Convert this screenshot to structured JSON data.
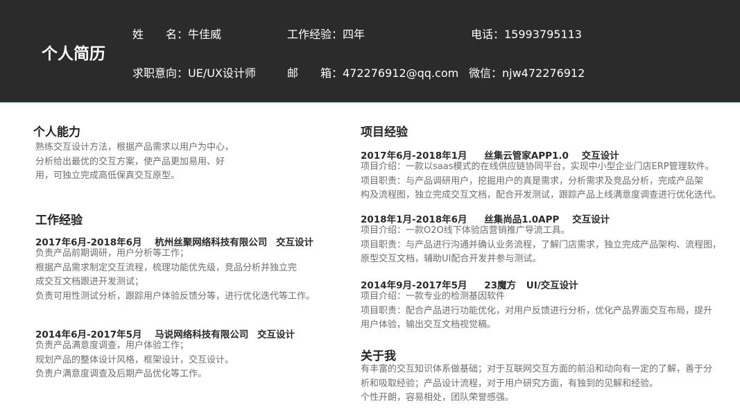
{
  "header": {
    "title": "个人简历",
    "name": "姓　　名：牛佳威",
    "experience": "工作经验：四年",
    "phone": "电话：15993795113",
    "objective": "求职意向：UE/UX设计师",
    "email": "邮　　箱：472276912@qq.com",
    "wechat": "微信：njw472276912"
  },
  "ability": {
    "title": "个人能力",
    "lines": [
      "熟练交互设计方法，根据产品需求以用户为中心，",
      "分析给出最优的交互方案，使产品更加易用、好",
      "用，可独立完成高低保真交互原型。"
    ]
  },
  "work": {
    "title": "工作经验",
    "jobs": [
      {
        "period": "2017年6月-2018年6月",
        "company": "杭州丝聚网络科技有限公司",
        "role": "交互设计",
        "lines": [
          "负责产品前期调研，用户分析等工作；",
          "根据产品需求制定交互流程，梳理功能优先级，竞品分析并独立完",
          "成交互文档跟进开发测试；",
          "负责可用性测试分析，跟踪用户体验反馈分等，进行优化迭代等工作。"
        ]
      },
      {
        "period": "2014年6月-2017年5月",
        "company": "马说网络科技有限公司",
        "role": "交互设计",
        "lines": [
          "负责产品满意度调查，用户体验工作；",
          "规划产品的整体设计风格，框架设计，交互设计。",
          "负责户满意度调查及后期产品优化等工作。"
        ]
      }
    ]
  },
  "projects": {
    "title": "项目经验",
    "items": [
      {
        "period": "2017年6月-2018年1月",
        "name": "丝集云管家APP1.0",
        "role": "交互设计",
        "lines": [
          "项目介绍：一款以saas模式的在线供应链协同平台，实现中小型企业门店ERP管理软件。",
          "项目职责：与产品调研用户，挖掘用户的真是需求，分析需求及竞品分析，完成产品架",
          "构及流程图，独立完成交互文档，配合开发测试，跟踪产品上线满意度调查进行优化迭代。"
        ]
      },
      {
        "period": "2018年1月-2018年6月",
        "name": "丝集尚品1.0APP",
        "role": "交互设计",
        "lines": [
          "项目介绍：一款O2O线下体验店营销推广导流工具。",
          "项目职责：与产品进行沟通并确认业务流程，了解门店需求，独立完成产品架构、流程图，",
          "原型交互文档，辅助UI配合开发并参与测试。"
        ]
      },
      {
        "period": "2014年9月-2017年5月",
        "name": "23魔方",
        "role": "UI/交互设计",
        "lines": [
          "项目介绍：一款专业的检测基因软件",
          "项目职责：配合产品进行功能优化，对用户反馈进行分析，优化产品界面交互布局，提升",
          "用户体验，输出交互文档视觉稿。"
        ]
      }
    ]
  },
  "about": {
    "title": "关于我",
    "lines": [
      "有丰富的交互知识体系做基础；对于互联网交互方面的前沿和动向有一定的了解，善于分",
      "析和吸取经验；产品设计流程，对于用户研究方面，有独到的见解和经验。",
      "个性开朗，容易相处，团队荣誉感强。"
    ]
  }
}
